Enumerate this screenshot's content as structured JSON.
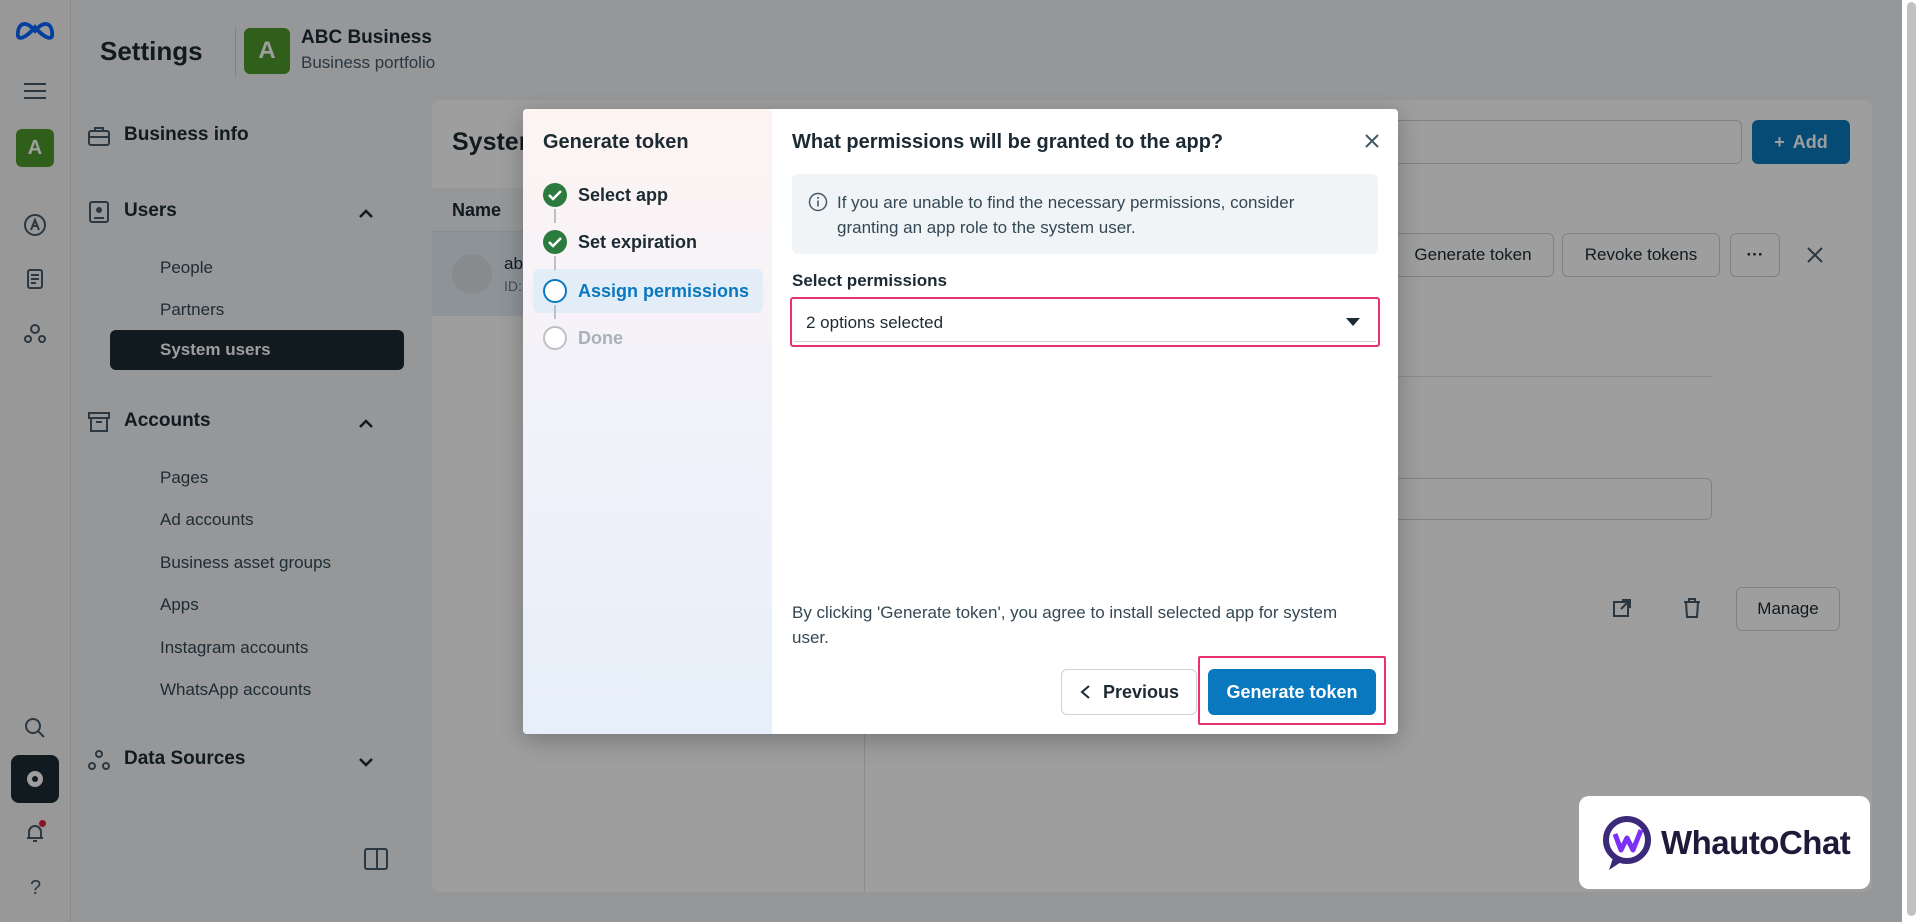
{
  "header": {
    "title": "Settings",
    "business_avatar_letter": "A",
    "business_name": "ABC Business",
    "business_subtitle": "Business portfolio"
  },
  "rail": {
    "avatar_letter": "A",
    "icons": [
      "meta-logo-icon",
      "menu-icon",
      "ads-icon",
      "pages-icon",
      "people-icon",
      "search-icon",
      "settings-icon",
      "bell-icon",
      "help-icon"
    ]
  },
  "sidebar": {
    "business_info": "Business info",
    "users": {
      "label": "Users",
      "items": [
        "People",
        "Partners",
        "System users"
      ]
    },
    "accounts": {
      "label": "Accounts",
      "items": [
        "Pages",
        "Ad accounts",
        "Business asset groups",
        "Apps",
        "Instagram accounts",
        "WhatsApp accounts"
      ]
    },
    "data_sources": "Data Sources"
  },
  "content": {
    "title": "Syster",
    "list_header": "Name",
    "row_name": "ab",
    "row_id": "ID:",
    "add_label": "Add",
    "generate_token_label": "Generate token",
    "revoke_tokens_label": "Revoke tokens",
    "more_label": "···",
    "manage_label": "Manage"
  },
  "modal": {
    "steps_title": "Generate token",
    "steps": [
      {
        "label": "Select app",
        "state": "done"
      },
      {
        "label": "Set expiration",
        "state": "done"
      },
      {
        "label": "Assign permissions",
        "state": "current"
      },
      {
        "label": "Done",
        "state": "todo"
      }
    ],
    "title": "What permissions will be granted to the app?",
    "info_text": "If you are unable to find the necessary permissions, consider granting an app role to the system user.",
    "select_label": "Select permissions",
    "select_value": "2 options selected",
    "agreement": "By clicking 'Generate token', you agree to install selected app for system user.",
    "previous_label": "Previous",
    "generate_label": "Generate token"
  },
  "brand": {
    "name": "WhautoChat"
  },
  "colors": {
    "primary": "#0a78be",
    "highlight": "#e8336d",
    "done_green": "#2b7a3e",
    "nav_active": "#1c2b33"
  }
}
